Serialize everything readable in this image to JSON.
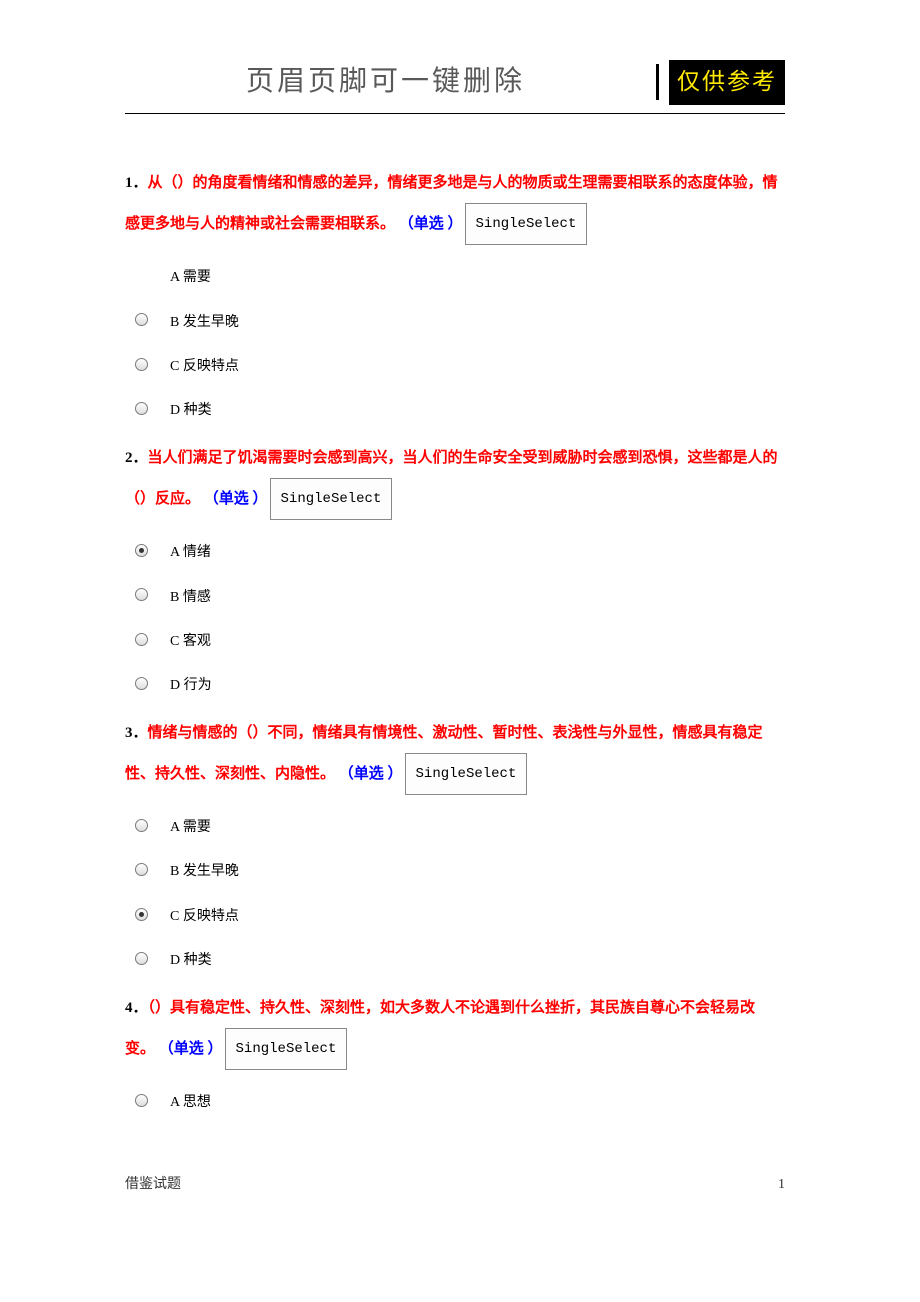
{
  "header": {
    "main": "页眉页脚可一键删除",
    "badge": "仅供参考"
  },
  "tag_label": "SingleSelect",
  "questions": [
    {
      "num": "1．",
      "text": "从（）的角度看情绪和情感的差异，情绪更多地是与人的物质或生理需要相联系的态度体验，情感更多地与人的精神或社会需要相联系。",
      "type": "（单选 ）",
      "options": [
        {
          "label": "A 需要",
          "has_radio": false,
          "selected": false
        },
        {
          "label": "B 发生早晚",
          "has_radio": true,
          "selected": false
        },
        {
          "label": "C 反映特点",
          "has_radio": true,
          "selected": false
        },
        {
          "label": "D 种类",
          "has_radio": true,
          "selected": false
        }
      ]
    },
    {
      "num": "2．",
      "text": "当人们满足了饥渴需要时会感到高兴，当人们的生命安全受到威胁时会感到恐惧，这些都是人的（）反应。",
      "type": "（单选 ）",
      "options": [
        {
          "label": "A 情绪",
          "has_radio": true,
          "selected": true
        },
        {
          "label": "B 情感",
          "has_radio": true,
          "selected": false
        },
        {
          "label": "C 客观",
          "has_radio": true,
          "selected": false
        },
        {
          "label": "D 行为",
          "has_radio": true,
          "selected": false
        }
      ]
    },
    {
      "num": "3．",
      "text": "情绪与情感的（）不同，情绪具有情境性、激动性、暂时性、表浅性与外显性，情感具有稳定性、持久性、深刻性、内隐性。",
      "type": "（单选 ）",
      "options": [
        {
          "label": "A 需要",
          "has_radio": true,
          "selected": false
        },
        {
          "label": "B 发生早晚",
          "has_radio": true,
          "selected": false
        },
        {
          "label": "C 反映特点",
          "has_radio": true,
          "selected": true
        },
        {
          "label": "D 种类",
          "has_radio": true,
          "selected": false
        }
      ]
    },
    {
      "num": "4．",
      "text": "（）具有稳定性、持久性、深刻性，如大多数人不论遇到什么挫折，其民族自尊心不会轻易改变。",
      "type": "（单选 ）",
      "options": [
        {
          "label": "A 思想",
          "has_radio": true,
          "selected": false
        }
      ]
    }
  ],
  "footer": {
    "left": "借鉴试题",
    "right": "1"
  }
}
